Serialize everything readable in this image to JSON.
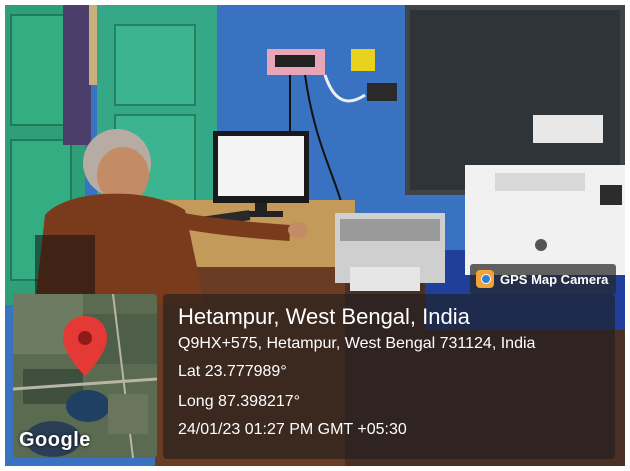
{
  "badge": {
    "label": "GPS Map Camera",
    "icon": "gps-map-camera-icon"
  },
  "location": {
    "title": "Hetampur, West Bengal, India",
    "address": "Q9HX+575, Hetampur, West Bengal 731124, India",
    "lat": "Lat 23.777989°",
    "long": "Long 87.398217°",
    "datetime": "24/01/23 01:27 PM GMT +05:30"
  },
  "map": {
    "logo": "Google",
    "pin_icon": "map-pin-icon"
  },
  "colors": {
    "pin": "#e53935",
    "wall": "#3b74c5",
    "door": "#2fa57a"
  }
}
